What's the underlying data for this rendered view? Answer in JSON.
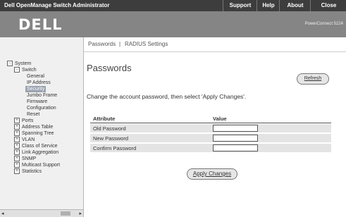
{
  "app": {
    "title": "Dell OpenManage Switch Administrator",
    "links": [
      "Support",
      "Help",
      "About",
      "Close"
    ]
  },
  "header": {
    "logo": "DELL",
    "model": "PowerConnect 5224"
  },
  "sidebar": {
    "tree": [
      {
        "label": "System",
        "expander": "−"
      },
      {
        "label": "Switch",
        "expander": "−"
      },
      {
        "label": "General"
      },
      {
        "label": "IP Address"
      },
      {
        "label": "Security",
        "selected": true
      },
      {
        "label": "Jumbo Frame"
      },
      {
        "label": "Firmware"
      },
      {
        "label": "Configuration"
      },
      {
        "label": "Reset"
      },
      {
        "label": "Ports",
        "expander": "+"
      },
      {
        "label": "Address Table",
        "expander": "+"
      },
      {
        "label": "Spanning Tree",
        "expander": "+"
      },
      {
        "label": "VLAN",
        "expander": "+"
      },
      {
        "label": "Class of Service",
        "expander": "+"
      },
      {
        "label": "Link Aggregation",
        "expander": "+"
      },
      {
        "label": "SNMP",
        "expander": "+"
      },
      {
        "label": "Multicast Support",
        "expander": "+"
      },
      {
        "label": "Statistics",
        "expander": "+"
      }
    ]
  },
  "subnav": {
    "items": [
      "Passwords",
      "RADIUS Settings"
    ],
    "separator": "|"
  },
  "main": {
    "title": "Passwords",
    "refresh_label": "Refresh",
    "instructions": "Change the account password, then select 'Apply Changes'.",
    "table": {
      "headers": [
        "Attribute",
        "Value"
      ],
      "rows": [
        {
          "attribute": "Old Password",
          "value": ""
        },
        {
          "attribute": "New Password",
          "value": ""
        },
        {
          "attribute": "Confirm Password",
          "value": ""
        }
      ]
    },
    "apply_label": "Apply Changes"
  }
}
